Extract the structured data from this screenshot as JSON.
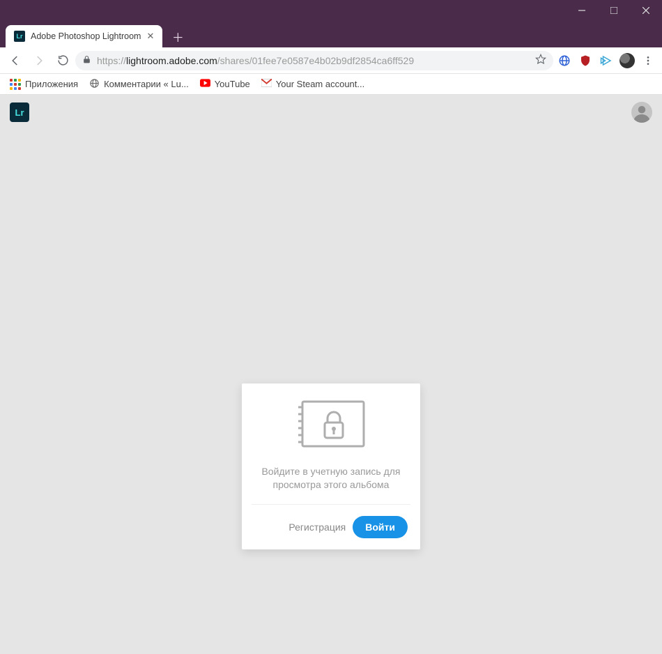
{
  "browser": {
    "tab_title": "Adobe Photoshop Lightroom",
    "tab_favicon_text": "Lr",
    "url_proto": "https://",
    "url_host": "lightroom.adobe.com",
    "url_path": "/shares/01fee7e0587e4b02b9df2854ca6ff529"
  },
  "bookmarks": {
    "apps": "Приложения",
    "item1": "Комментарии « Lu...",
    "item2": "YouTube",
    "item3": "Your Steam account..."
  },
  "page": {
    "logo_text": "Lr"
  },
  "card": {
    "message": "Войдите в учетную запись для просмотра этого альбома",
    "register_label": "Регистрация",
    "login_label": "Войти"
  },
  "colors": {
    "accent": "#1792e6",
    "titlebar": "#4a2b4a",
    "page_bg": "#e5e5e5"
  }
}
